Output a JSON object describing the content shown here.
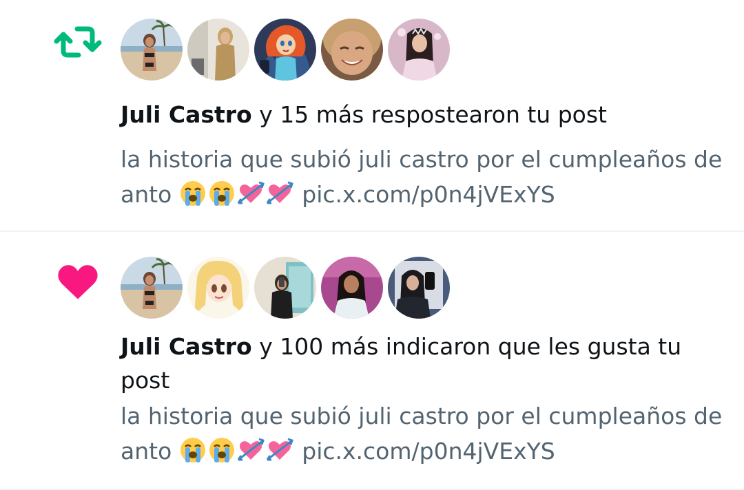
{
  "notifications": [
    {
      "kind": "repost",
      "icon": "repost-icon",
      "icon_color": "#00ba7c",
      "avatars": [
        "avatar-beach",
        "avatar-blonde-woman",
        "avatar-cartoon-fairy",
        "avatar-smiling-woman",
        "avatar-woman-tiara"
      ],
      "actor": "Juli Castro",
      "action": " y 15 más respostearon tu post",
      "snippet_text": "la historia que subió juli castro por el cumpleaños de anto ",
      "link": "pic.x.com/p0n4jVExYS"
    },
    {
      "kind": "like",
      "icon": "heart-icon",
      "icon_color": "#f91880",
      "avatars": [
        "avatar-beach",
        "avatar-anime-girl",
        "avatar-mirror-selfie",
        "avatar-dark-hair-woman",
        "avatar-phone-selfie"
      ],
      "actor": "Juli Castro",
      "action": " y 100 más indicaron que les gusta tu post",
      "snippet_text": "la historia que subió juli castro por el cumpleaños de anto ",
      "link": "pic.x.com/p0n4jVExYS"
    }
  ],
  "emoji_names": [
    "loudly-crying-face",
    "loudly-crying-face",
    "heart-with-arrow",
    "heart-with-arrow"
  ]
}
